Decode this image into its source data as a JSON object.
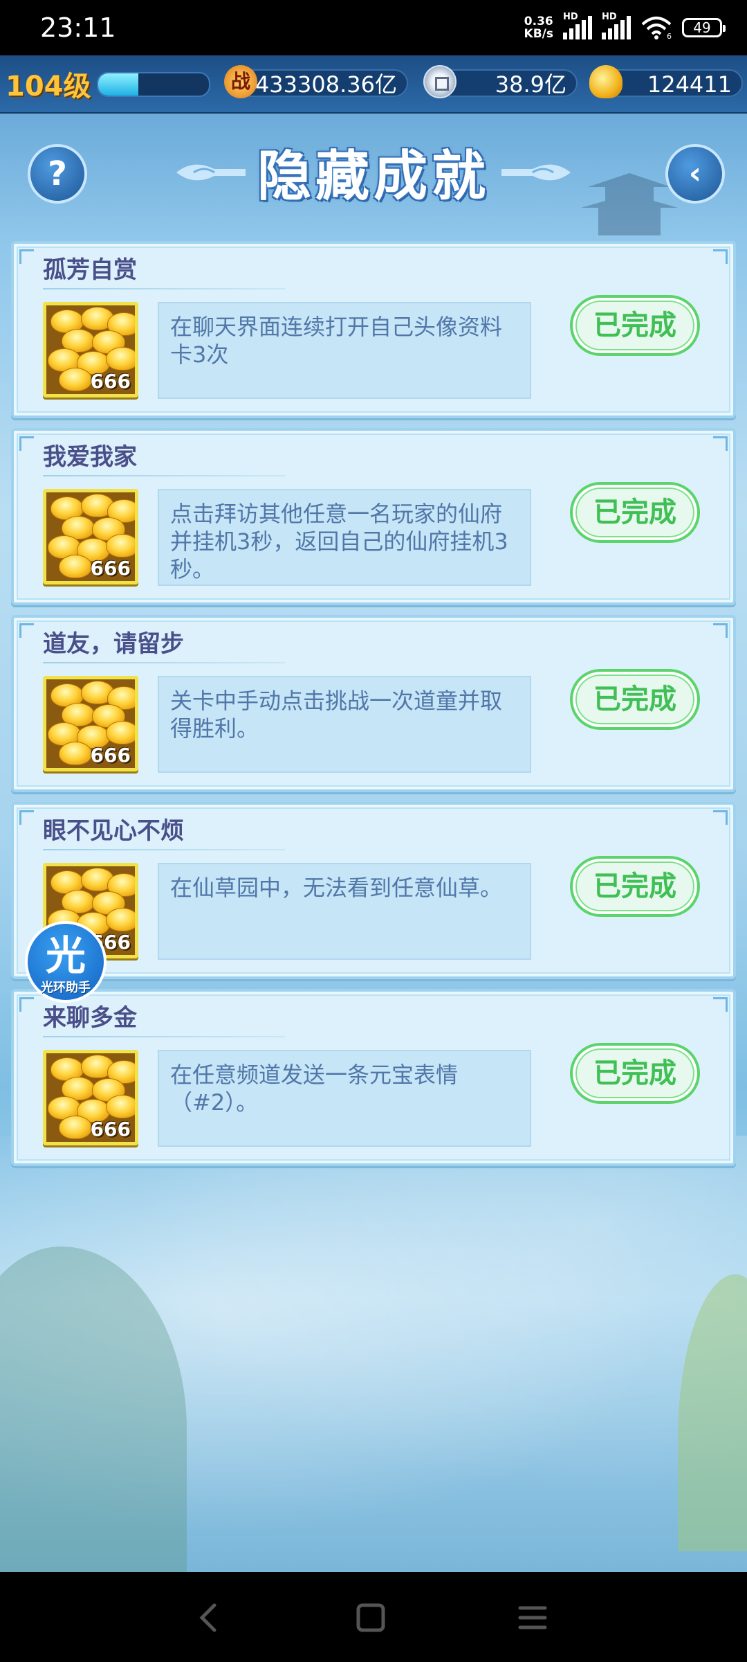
{
  "status_bar": {
    "time": "23:11",
    "net_speed_value": "0.36",
    "net_speed_unit": "KB/s",
    "signal_tag_1": "HD",
    "signal_tag_2": "HD",
    "signal_sub": "6",
    "battery": "49"
  },
  "resources": {
    "level": "104级",
    "exp_fraction": 0.36,
    "battle_icon_char": "战",
    "battle_power": "433308.36亿",
    "coins": "38.9亿",
    "ingots": "124411"
  },
  "header": {
    "title": "隐藏成就",
    "help_glyph": "?",
    "back_glyph": "‹"
  },
  "achievements": [
    {
      "title": "孤芳自赏",
      "reward_count": "666",
      "description": "在聊天界面连续打开自己头像资料卡3次",
      "status": "已完成"
    },
    {
      "title": "我爱我家",
      "reward_count": "666",
      "description": "点击拜访其他任意一名玩家的仙府并挂机3秒，返回自己的仙府挂机3秒。",
      "status": "已完成"
    },
    {
      "title": "道友，请留步",
      "reward_count": "666",
      "description": "关卡中手动点击挑战一次道童并取得胜利。",
      "status": "已完成"
    },
    {
      "title": "眼不见心不烦",
      "reward_count": "666",
      "description": "在仙草园中，无法看到任意仙草。",
      "status": "已完成"
    },
    {
      "title": "来聊多金",
      "reward_count": "666",
      "description": "在任意频道发送一条元宝表情（#2）。",
      "status": "已完成"
    }
  ],
  "assistant": {
    "badge": "光",
    "label": "光环助手"
  },
  "nav_icons": [
    "back-icon",
    "home-icon",
    "menu-icon"
  ],
  "colors": {
    "accent_green": "#3fbf54",
    "level_gold": "#ffc53a",
    "title_purple": "#4a4f8a"
  }
}
